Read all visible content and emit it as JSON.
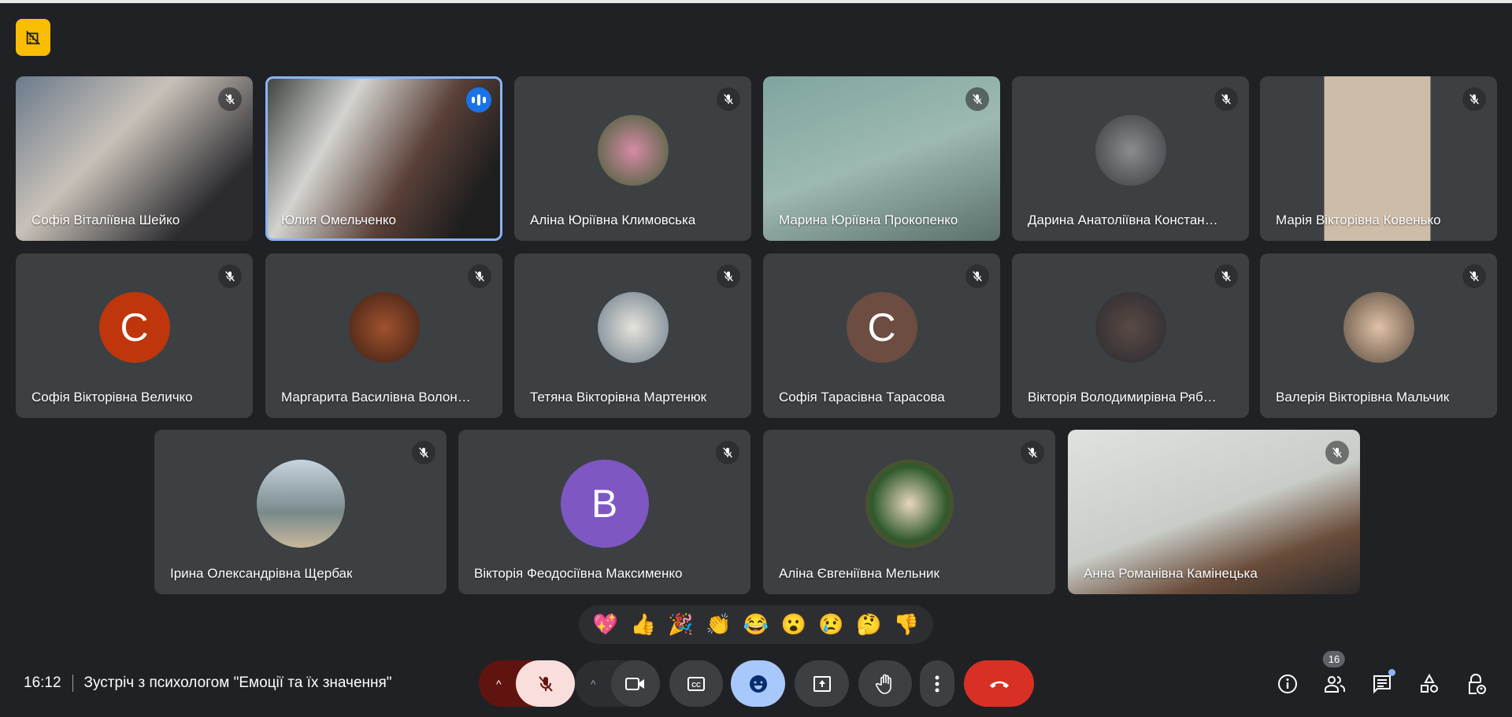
{
  "meeting": {
    "time": "16:12",
    "title": "Зустріч з психологом \"Емоції та їх значення\"",
    "participant_count": "16"
  },
  "colors": {
    "accent": "#8ab4f8",
    "end_call": "#d93025",
    "mic_off_bg": "#f9dedc",
    "mic_group_bg": "#601410",
    "emoji_active": "#a8c7fa",
    "pin": "#fbbc04"
  },
  "tiles": [
    {
      "name": "Софія Віталіївна Шейко",
      "type": "video",
      "muted": true,
      "bg": "linear-gradient(135deg,#6a7a8c,#c9c1b8 40%,#2c2c30 80%)"
    },
    {
      "name": "Юлия Омельченко",
      "type": "video",
      "muted": false,
      "speaking": true,
      "bg": "linear-gradient(120deg,#3a3f3a,#d3d3cf 30%,#5a4038 60%,#1e1e1e 85%)"
    },
    {
      "name": "Аліна Юріївна Климовська",
      "type": "photo",
      "muted": true,
      "bg": "radial-gradient(circle,#d68aa6,#3f5e32)"
    },
    {
      "name": "Марина Юріївна Прокопенко",
      "type": "video",
      "muted": true,
      "bg": "linear-gradient(160deg,#7fa5a0,#9db9b1 50%,#5a6f6a)"
    },
    {
      "name": "Дарина Анатоліївна Констан…",
      "type": "photo",
      "muted": true,
      "bg": "radial-gradient(circle,#8a8c90,#3b3c40)"
    },
    {
      "name": "Марія Вікторівна Ковенько",
      "type": "video",
      "muted": true,
      "bg": "linear-gradient(90deg,#3c4043 0 27%,#cdbca8 27% 72%,#3c4043 72%)"
    },
    {
      "name": "Софія Вікторівна Величко",
      "type": "letter",
      "letter": "C",
      "muted": true,
      "bg": "#bf360c"
    },
    {
      "name": "Маргарита Василівна Волон…",
      "type": "photo",
      "muted": true,
      "bg": "radial-gradient(circle,#a0522d,#3b1f15)"
    },
    {
      "name": "Тетяна Вікторівна Мартенюк",
      "type": "photo",
      "muted": true,
      "bg": "radial-gradient(circle,#e6e3dc,#6b7c8a)"
    },
    {
      "name": "Софія Тарасівна Тарасова",
      "type": "letter",
      "letter": "C",
      "muted": true,
      "bg": "#6d4c41"
    },
    {
      "name": "Вікторія Володимирівна Ряб…",
      "type": "photo",
      "muted": true,
      "bg": "radial-gradient(circle,#5a4a44,#2a2a30)"
    },
    {
      "name": "Валерія Вікторівна Мальчик",
      "type": "photo",
      "muted": true,
      "bg": "radial-gradient(circle,#e0c2a8,#5a4a3c)"
    },
    {
      "name": "Ірина Олександрівна Щербак",
      "type": "photo",
      "muted": true,
      "bg": "linear-gradient(#c7d3de,#7a8a8c 60%,#c8b79c)"
    },
    {
      "name": "Вікторія Феодосіївна Максименко",
      "type": "letter",
      "letter": "B",
      "muted": true,
      "bg": "#7e57c2"
    },
    {
      "name": "Аліна Євгеніївна Мельник",
      "type": "photo",
      "muted": true,
      "bg": "radial-gradient(circle,#e8d6c0,#2f5a2c 60%,#a8323a)"
    },
    {
      "name": "Анна Романівна Камінецька",
      "type": "video",
      "muted": true,
      "bg": "linear-gradient(160deg,#dfe3e0,#c9cdc8 50%,#6a4c3a 75%,#2b2a2a)"
    }
  ],
  "reactions": [
    "💖",
    "👍",
    "🎉",
    "👏",
    "😂",
    "😮",
    "😢",
    "🤔",
    "👎"
  ],
  "icons": {
    "pin": "pin-off-icon",
    "mic": "mic-off-icon",
    "camera": "videocam-icon",
    "captions": "captions-icon",
    "emoji": "emoji-icon",
    "present": "present-icon",
    "hand": "raise-hand-icon",
    "more": "more-vert-icon",
    "end": "call-end-icon",
    "info": "info-icon",
    "people": "people-icon",
    "chat": "chat-icon",
    "activities": "activities-icon",
    "host": "host-controls-icon"
  }
}
